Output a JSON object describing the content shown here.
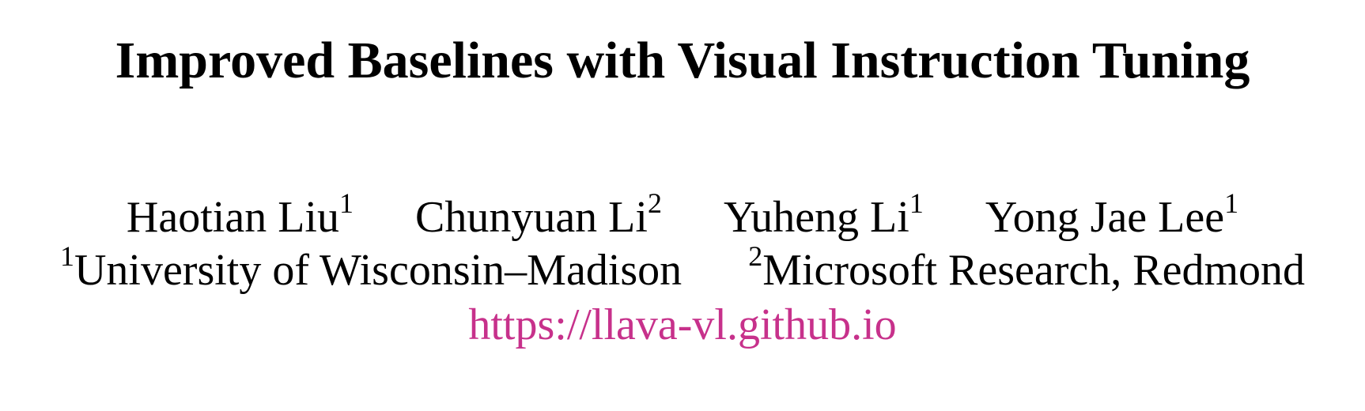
{
  "title": "Improved Baselines with Visual Instruction Tuning",
  "authors": [
    {
      "name": "Haotian Liu",
      "affil": "1"
    },
    {
      "name": "Chunyuan Li",
      "affil": "2"
    },
    {
      "name": "Yuheng Li",
      "affil": "1"
    },
    {
      "name": "Yong Jae Lee",
      "affil": "1"
    }
  ],
  "affiliations": [
    {
      "mark": "1",
      "name": "University of Wisconsin–Madison"
    },
    {
      "mark": "2",
      "name": "Microsoft Research, Redmond"
    }
  ],
  "project_url": "https://llava-vl.github.io",
  "colors": {
    "link": "#c7318b",
    "text": "#000000"
  }
}
